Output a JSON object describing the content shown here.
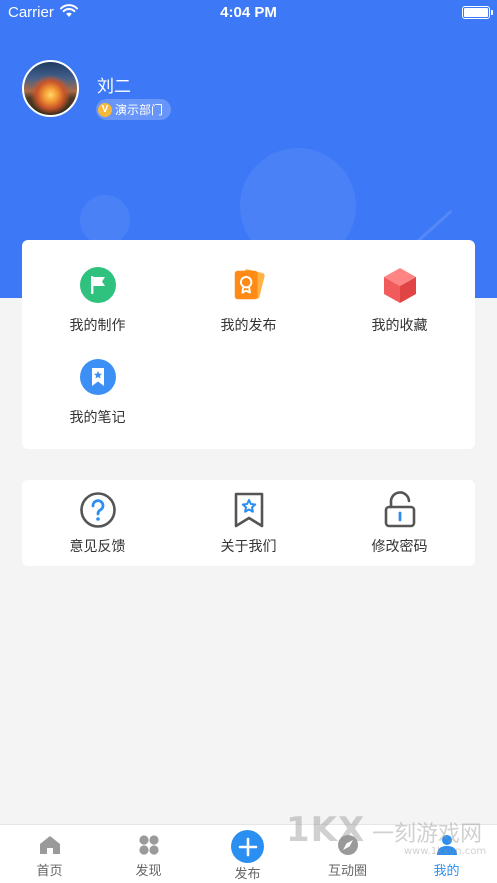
{
  "status_bar": {
    "carrier": "Carrier",
    "time": "4:04 PM"
  },
  "profile": {
    "name": "刘二",
    "badge_letter": "V",
    "department": "演示部门"
  },
  "functions": [
    {
      "label": "我的制作",
      "icon": "flag-icon",
      "color": "#2ec27e"
    },
    {
      "label": "我的发布",
      "icon": "certificate-cards-icon",
      "color": "#ff8a16"
    },
    {
      "label": "我的收藏",
      "icon": "cube-icon",
      "color": "#f25b5b"
    },
    {
      "label": "我的笔记",
      "icon": "bookmark-star-icon",
      "color": "#3b8ff5"
    }
  ],
  "settings": [
    {
      "label": "意见反馈",
      "icon": "question-circle-icon"
    },
    {
      "label": "关于我们",
      "icon": "bookmark-star-outline-icon"
    },
    {
      "label": "修改密码",
      "icon": "unlock-icon"
    }
  ],
  "tabbar": {
    "active_color": "#2b8ff2",
    "items": [
      {
        "label": "首页",
        "icon": "home-icon"
      },
      {
        "label": "发现",
        "icon": "grid-clover-icon"
      },
      {
        "label": "发布",
        "icon": "plus-circle-icon"
      },
      {
        "label": "互动圈",
        "icon": "compass-icon"
      },
      {
        "label": "我的",
        "icon": "user-icon",
        "active": true
      }
    ]
  },
  "watermark": {
    "mark": "1KX",
    "text": "一刻游戏网",
    "url": "www.1kxun.com"
  }
}
